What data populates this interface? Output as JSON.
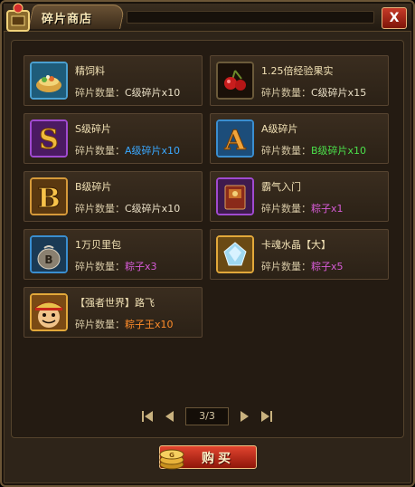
{
  "window": {
    "title": "碎片商店",
    "close_label": "X"
  },
  "items": [
    {
      "name": "精饲料",
      "qty_label": "碎片数量：",
      "cost": "C级碎片x10",
      "cost_color": "#e9dfc6",
      "icon": "feed-icon"
    },
    {
      "name": "1.25倍经验果实",
      "qty_label": "碎片数量：",
      "cost": "C级碎片x15",
      "cost_color": "#e9dfc6",
      "icon": "exp-fruit-icon"
    },
    {
      "name": "S级碎片",
      "qty_label": "碎片数量：",
      "cost": "A级碎片x10",
      "cost_color": "#3aa8ff",
      "icon": "s-fragment-icon"
    },
    {
      "name": "A级碎片",
      "qty_label": "碎片数量：",
      "cost": "B级碎片x10",
      "cost_color": "#4be04b",
      "icon": "a-fragment-icon"
    },
    {
      "name": "B级碎片",
      "qty_label": "碎片数量：",
      "cost": "C级碎片x10",
      "cost_color": "#e9dfc6",
      "icon": "b-fragment-icon"
    },
    {
      "name": "霸气入门",
      "qty_label": "碎片数量：",
      "cost": "粽子x1",
      "cost_color": "#d65bd6",
      "icon": "book-icon"
    },
    {
      "name": "1万贝里包",
      "qty_label": "碎片数量：",
      "cost": "粽子x3",
      "cost_color": "#d65bd6",
      "icon": "money-bag-icon"
    },
    {
      "name": "卡魂水晶【大】",
      "qty_label": "碎片数量：",
      "cost": "粽子x5",
      "cost_color": "#d65bd6",
      "icon": "crystal-icon"
    },
    {
      "name": "【强者世界】路飞",
      "qty_label": "碎片数量：",
      "cost": "粽子王x10",
      "cost_color": "#ff8c2a",
      "icon": "luffy-icon"
    }
  ],
  "pager": {
    "page": "3/3"
  },
  "buy_button": {
    "label": "购买"
  }
}
